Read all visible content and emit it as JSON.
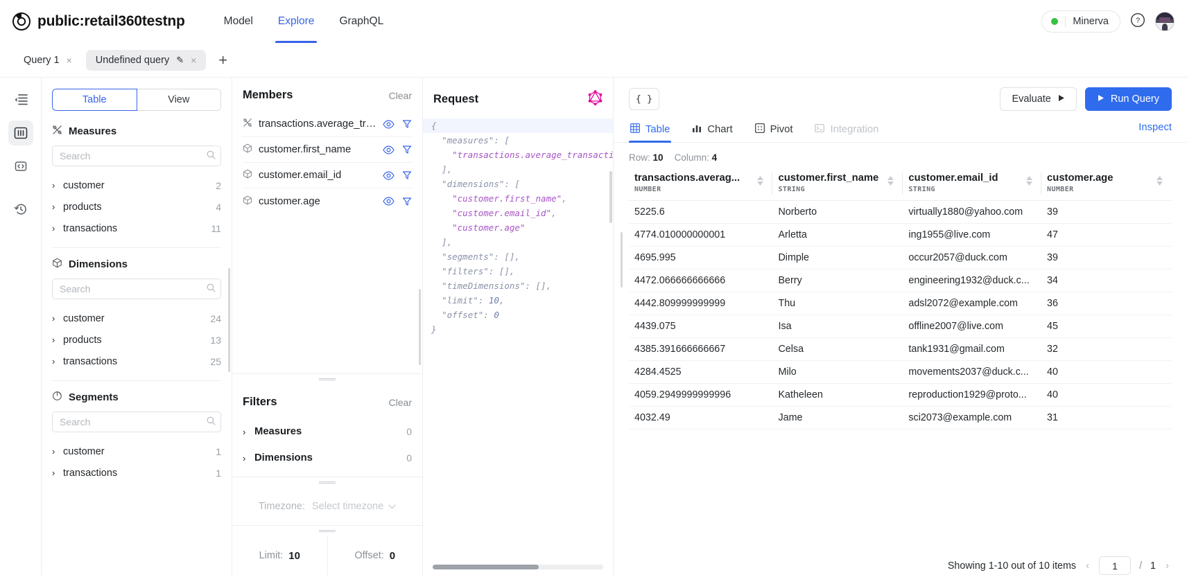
{
  "header": {
    "logo_icon": "cube-logo-icon",
    "project_name": "public:retail360testnp",
    "nav": [
      {
        "label": "Model",
        "active": false
      },
      {
        "label": "Explore",
        "active": true
      },
      {
        "label": "GraphQL",
        "active": false
      }
    ],
    "environment": {
      "label": "Minerva",
      "status_color": "#36c23f"
    },
    "help_icon": "question-circle-icon",
    "avatar_icon": "user-avatar"
  },
  "query_tabs": {
    "tabs": [
      {
        "label": "Query 1",
        "active": false,
        "editable": false
      },
      {
        "label": "Undefined query",
        "active": true,
        "editable": true
      }
    ],
    "add_label": "+",
    "close_label": "×",
    "edit_label": "✎"
  },
  "rail": {
    "items": [
      {
        "name": "sidebar-collapse-icon",
        "active": false
      },
      {
        "name": "data-model-icon",
        "active": true
      },
      {
        "name": "code-icon",
        "active": false
      },
      {
        "name": "history-icon",
        "active": false
      }
    ]
  },
  "explorer": {
    "toggle": {
      "options": [
        "Table",
        "View"
      ],
      "selected": "Table"
    },
    "sections": [
      {
        "title": "Measures",
        "icon": "measure-icon",
        "search_placeholder": "Search",
        "search_value": "",
        "cubes": [
          {
            "name": "customer",
            "count": "2"
          },
          {
            "name": "products",
            "count": "4"
          },
          {
            "name": "transactions",
            "count": "11"
          }
        ]
      },
      {
        "title": "Dimensions",
        "icon": "dimension-cube-icon",
        "search_placeholder": "Search",
        "search_value": "",
        "cubes": [
          {
            "name": "customer",
            "count": "24"
          },
          {
            "name": "products",
            "count": "13"
          },
          {
            "name": "transactions",
            "count": "25"
          }
        ]
      },
      {
        "title": "Segments",
        "icon": "segment-pie-icon",
        "search_placeholder": "Search",
        "search_value": "",
        "cubes": [
          {
            "name": "customer",
            "count": "1"
          },
          {
            "name": "transactions",
            "count": "1"
          }
        ]
      }
    ]
  },
  "members_panel": {
    "title": "Members",
    "clear_label": "Clear",
    "items": [
      {
        "name": "transactions.average_tra...",
        "type_icon": "measure-icon"
      },
      {
        "name": "customer.first_name",
        "type_icon": "dimension-cube-icon"
      },
      {
        "name": "customer.email_id",
        "type_icon": "dimension-cube-icon"
      },
      {
        "name": "customer.age",
        "type_icon": "dimension-cube-icon"
      }
    ],
    "eye_icon": "eye-icon",
    "filter_icon": "funnel-icon"
  },
  "filters_panel": {
    "title": "Filters",
    "clear_label": "Clear",
    "groups": [
      {
        "label": "Measures",
        "count": "0"
      },
      {
        "label": "Dimensions",
        "count": "0"
      }
    ],
    "timezone": {
      "label": "Timezone:",
      "value": "Select timezone",
      "chevron": "chevron-down-icon"
    },
    "limit": {
      "label": "Limit:",
      "value": "10"
    },
    "offset": {
      "label": "Offset:",
      "value": "0"
    }
  },
  "request_panel": {
    "title": "Request",
    "graphql_icon": "graphql-icon",
    "code_lines": [
      {
        "indent": 0,
        "text": "{",
        "highlight": true
      },
      {
        "indent": 1,
        "text": "\"measures\": ["
      },
      {
        "indent": 2,
        "text": "\"transactions.average_transactio"
      },
      {
        "indent": 1,
        "text": "],"
      },
      {
        "indent": 1,
        "text": "\"dimensions\": ["
      },
      {
        "indent": 2,
        "text": "\"customer.first_name\","
      },
      {
        "indent": 2,
        "text": "\"customer.email_id\","
      },
      {
        "indent": 2,
        "text": "\"customer.age\""
      },
      {
        "indent": 1,
        "text": "],"
      },
      {
        "indent": 1,
        "text": "\"segments\": [],"
      },
      {
        "indent": 1,
        "text": "\"filters\": [],"
      },
      {
        "indent": 1,
        "text": "\"timeDimensions\": [],"
      },
      {
        "indent": 1,
        "text": "\"limit\": 10,"
      },
      {
        "indent": 1,
        "text": "\"offset\": 0"
      },
      {
        "indent": 0,
        "text": "}"
      }
    ]
  },
  "results": {
    "json_button": "{ }",
    "evaluate_button": "Evaluate",
    "run_button": "Run Query",
    "play_icon": "play-icon",
    "view_tabs": [
      {
        "label": "Table",
        "icon": "table-icon",
        "active": true,
        "disabled": false
      },
      {
        "label": "Chart",
        "icon": "bar-chart-icon",
        "active": false,
        "disabled": false
      },
      {
        "label": "Pivot",
        "icon": "pivot-icon",
        "active": false,
        "disabled": false
      },
      {
        "label": "Integration",
        "icon": "terminal-icon",
        "active": false,
        "disabled": true
      }
    ],
    "inspect_label": "Inspect",
    "row_label": "Row:",
    "row_count": "10",
    "column_label": "Column:",
    "column_count": "4",
    "columns": [
      {
        "name": "transactions.averag...",
        "type": "NUMBER",
        "width": "26%"
      },
      {
        "name": "customer.first_name",
        "type": "STRING",
        "width": "24%"
      },
      {
        "name": "customer.email_id",
        "type": "STRING",
        "width": "26%"
      },
      {
        "name": "customer.age",
        "type": "NUMBER",
        "width": "24%"
      }
    ],
    "rows": [
      [
        "5225.6",
        "Norberto",
        "virtually1880@yahoo.com",
        "39"
      ],
      [
        "4774.010000000001",
        "Arletta",
        "ing1955@live.com",
        "47"
      ],
      [
        "4695.995",
        "Dimple",
        "occur2057@duck.com",
        "39"
      ],
      [
        "4472.066666666666",
        "Berry",
        "engineering1932@duck.c...",
        "34"
      ],
      [
        "4442.809999999999",
        "Thu",
        "adsl2072@example.com",
        "36"
      ],
      [
        "4439.075",
        "Isa",
        "offline2007@live.com",
        "45"
      ],
      [
        "4385.391666666667",
        "Celsa",
        "tank1931@gmail.com",
        "32"
      ],
      [
        "4284.4525",
        "Milo",
        "movements2037@duck.c...",
        "40"
      ],
      [
        "4059.2949999999996",
        "Katheleen",
        "reproduction1929@proto...",
        "40"
      ],
      [
        "4032.49",
        "Jame",
        "sci2073@example.com",
        "31"
      ]
    ],
    "pagination": {
      "summary": "Showing 1-10 out of 10 items",
      "prev_icon": "chevron-left-icon",
      "next_icon": "chevron-right-icon",
      "current_page": "1",
      "separator": "/",
      "total_pages": "1"
    }
  },
  "colors": {
    "accent": "#2f6bed",
    "nav_active": "#3763e8",
    "status_green": "#36c23f",
    "graphql_pink": "#e10098",
    "code_string": "#a855c6"
  }
}
